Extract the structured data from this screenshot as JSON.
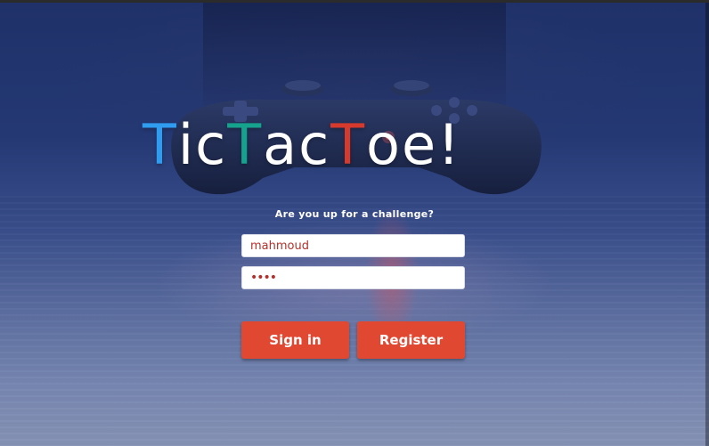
{
  "app": {
    "title_letters": [
      "T",
      "ic ",
      "T",
      "ac ",
      "T",
      "oe!"
    ],
    "subtitle": "Are you up for a challenge?"
  },
  "login": {
    "username_value": "mahmoud",
    "password_value": "abcd",
    "signin_label": "Sign in",
    "register_label": "Register"
  },
  "colors": {
    "title_t1": "#2f9cf0",
    "title_t2": "#16a38e",
    "title_t3": "#d63a2d",
    "button_bg": "#e04832",
    "field_text": "#b3312b"
  },
  "icons": {
    "background": "game-controller-photo"
  }
}
